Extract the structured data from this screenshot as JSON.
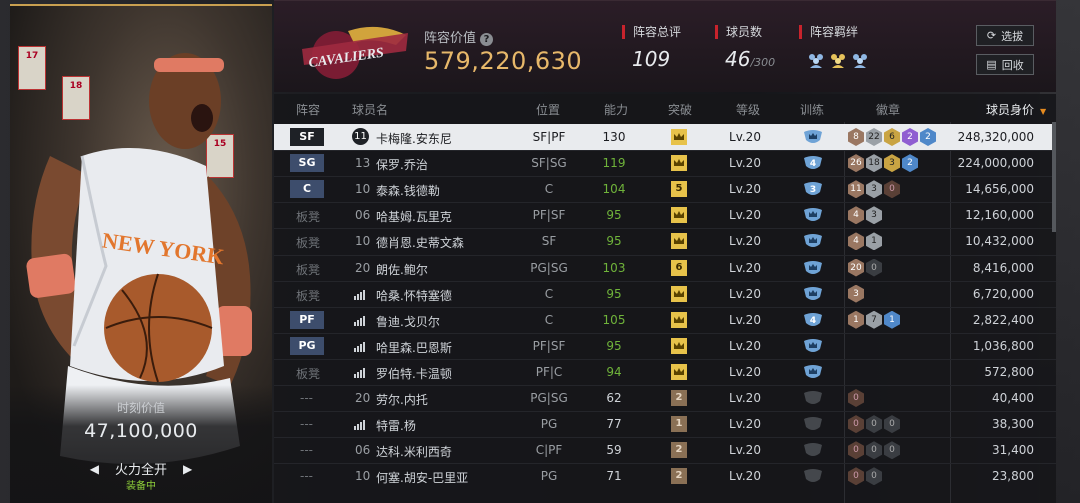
{
  "left_panel": {
    "player_jersey": "NEW YORK",
    "banners": [
      "17",
      "18",
      "15"
    ],
    "moment_label": "时刻价值",
    "moment_value": "47,100,000",
    "skill_name": "火力全开",
    "equipped": "装备中"
  },
  "header": {
    "team_logo_text": "CAVALIERS",
    "value_label": "阵容价值",
    "value_num": "579,220,630",
    "overall_label": "阵容总评",
    "overall_value": "109",
    "player_count_label": "球员数",
    "player_count_value": "46",
    "player_count_max": "/300",
    "bond_label": "阵容羁绊",
    "bond_icons": [
      "person-group-icon",
      "person-group-gold-icon",
      "person-group-icon"
    ],
    "select_button": "选拔",
    "recycle_button": "回收"
  },
  "table": {
    "columns": [
      "阵容",
      "球员名",
      "位置",
      "能力",
      "突破",
      "等级",
      "训练",
      "徽章",
      "球员身价"
    ],
    "rows": [
      {
        "slot": "SF",
        "slot_type": "starter",
        "num": "11",
        "num_style": "circle",
        "name": "卡梅隆.安东尼",
        "position": "SF|PF",
        "ability": "130",
        "ability_green": false,
        "breakthrough": "crown",
        "break_color": "gold",
        "level": "Lv.20",
        "train": "crown",
        "medals": [
          [
            "8",
            "bronze"
          ],
          [
            "22",
            "silver"
          ],
          [
            "6",
            "gold"
          ],
          [
            "2",
            "purple"
          ],
          [
            "2",
            "blue"
          ]
        ],
        "price": "248,320,000"
      },
      {
        "slot": "SG",
        "slot_type": "starter",
        "num": "13",
        "num_style": "plain",
        "name": "保罗.乔治",
        "position": "SF|SG",
        "ability": "119",
        "ability_green": true,
        "breakthrough": "crown",
        "break_color": "gold",
        "level": "Lv.20",
        "train": "4",
        "medals": [
          [
            "26",
            "bronze"
          ],
          [
            "18",
            "silver"
          ],
          [
            "3",
            "gold"
          ],
          [
            "2",
            "blue"
          ]
        ],
        "price": "224,000,000"
      },
      {
        "slot": "C",
        "slot_type": "starter",
        "num": "10",
        "num_style": "plain",
        "name": "泰森.钱德勒",
        "position": "C",
        "ability": "104",
        "ability_green": true,
        "breakthrough": "5",
        "break_color": "gold",
        "level": "Lv.20",
        "train": "3",
        "medals": [
          [
            "11",
            "bronze"
          ],
          [
            "3",
            "silver"
          ],
          [
            "0",
            "darkbrown"
          ]
        ],
        "price": "14,656,000"
      },
      {
        "slot": "板凳",
        "slot_type": "bench",
        "num": "06",
        "num_style": "plain",
        "name": "哈基姆.瓦里克",
        "position": "PF|SF",
        "ability": "95",
        "ability_green": true,
        "breakthrough": "crown",
        "break_color": "gold",
        "level": "Lv.20",
        "train": "crown",
        "medals": [
          [
            "4",
            "bronze"
          ],
          [
            "3",
            "silver"
          ]
        ],
        "price": "12,160,000"
      },
      {
        "slot": "板凳",
        "slot_type": "bench",
        "num": "10",
        "num_style": "plain",
        "name": "德肖恩.史蒂文森",
        "position": "SF",
        "ability": "95",
        "ability_green": true,
        "breakthrough": "crown",
        "break_color": "gold",
        "level": "Lv.20",
        "train": "crown",
        "medals": [
          [
            "4",
            "bronze"
          ],
          [
            "1",
            "silver"
          ]
        ],
        "price": "10,432,000"
      },
      {
        "slot": "板凳",
        "slot_type": "bench",
        "num": "20",
        "num_style": "plain",
        "name": "朗佐.鲍尔",
        "position": "PG|SG",
        "ability": "103",
        "ability_green": true,
        "breakthrough": "6",
        "break_color": "gold",
        "level": "Lv.20",
        "train": "crown",
        "medals": [
          [
            "20",
            "bronze"
          ],
          [
            "0",
            "dark"
          ]
        ],
        "price": "8,416,000"
      },
      {
        "slot": "板凳",
        "slot_type": "bench",
        "num": "",
        "num_style": "bars",
        "name": "哈桑.怀特塞德",
        "position": "C",
        "ability": "95",
        "ability_green": true,
        "breakthrough": "crown",
        "break_color": "gold",
        "level": "Lv.20",
        "train": "crown",
        "medals": [
          [
            "3",
            "bronze"
          ]
        ],
        "price": "6,720,000"
      },
      {
        "slot": "PF",
        "slot_type": "starter",
        "num": "",
        "num_style": "bars",
        "name": "鲁迪.戈贝尔",
        "position": "C",
        "ability": "105",
        "ability_green": true,
        "breakthrough": "crown",
        "break_color": "gold",
        "level": "Lv.20",
        "train": "4",
        "medals": [
          [
            "1",
            "bronze"
          ],
          [
            "7",
            "silver"
          ],
          [
            "1",
            "blue"
          ]
        ],
        "price": "2,822,400"
      },
      {
        "slot": "PG",
        "slot_type": "starter",
        "num": "",
        "num_style": "bars",
        "name": "哈里森.巴恩斯",
        "position": "PF|SF",
        "ability": "95",
        "ability_green": true,
        "breakthrough": "crown",
        "break_color": "gold",
        "level": "Lv.20",
        "train": "crown",
        "medals": [],
        "price": "1,036,800"
      },
      {
        "slot": "板凳",
        "slot_type": "bench",
        "num": "",
        "num_style": "bars",
        "name": "罗伯特.卡温顿",
        "position": "PF|C",
        "ability": "94",
        "ability_green": true,
        "breakthrough": "crown",
        "break_color": "gold",
        "level": "Lv.20",
        "train": "crown",
        "medals": [],
        "price": "572,800"
      },
      {
        "slot": "---",
        "slot_type": "none",
        "num": "20",
        "num_style": "plain",
        "name": "劳尔.内托",
        "position": "PG|SG",
        "ability": "62",
        "ability_green": false,
        "breakthrough": "2",
        "break_color": "brown",
        "level": "Lv.20",
        "train": "none",
        "medals": [
          [
            "0",
            "darkbrown"
          ]
        ],
        "price": "40,400"
      },
      {
        "slot": "---",
        "slot_type": "none",
        "num": "",
        "num_style": "bars",
        "name": "特雷.杨",
        "position": "PG",
        "ability": "77",
        "ability_green": false,
        "breakthrough": "1",
        "break_color": "brown",
        "level": "Lv.20",
        "train": "none",
        "medals": [
          [
            "0",
            "darkbrown"
          ],
          [
            "0",
            "dark"
          ],
          [
            "0",
            "dark"
          ]
        ],
        "price": "38,300"
      },
      {
        "slot": "---",
        "slot_type": "none",
        "num": "06",
        "num_style": "plain",
        "name": "达科.米利西奇",
        "position": "C|PF",
        "ability": "59",
        "ability_green": false,
        "breakthrough": "2",
        "break_color": "brown",
        "level": "Lv.20",
        "train": "none",
        "medals": [
          [
            "0",
            "darkbrown"
          ],
          [
            "0",
            "dark"
          ],
          [
            "0",
            "dark"
          ]
        ],
        "price": "31,400"
      },
      {
        "slot": "---",
        "slot_type": "none",
        "num": "10",
        "num_style": "plain",
        "name": "何塞.胡安-巴里亚",
        "position": "PG",
        "ability": "71",
        "ability_green": false,
        "breakthrough": "2",
        "break_color": "brown",
        "level": "Lv.20",
        "train": "none",
        "medals": [
          [
            "0",
            "darkbrown"
          ],
          [
            "0",
            "dark"
          ]
        ],
        "price": "23,800"
      }
    ]
  }
}
